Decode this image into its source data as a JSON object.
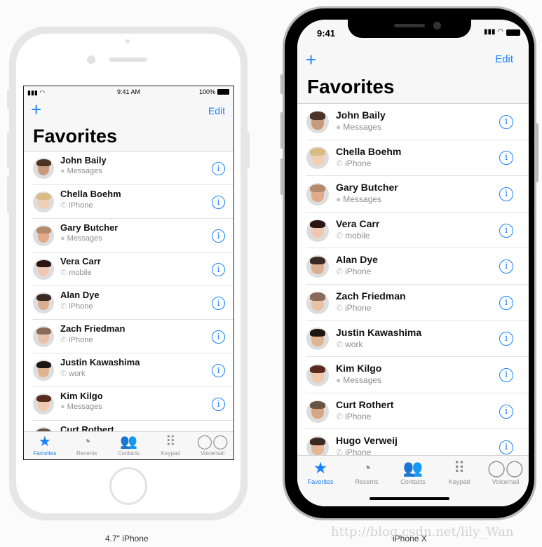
{
  "captions": {
    "left": "4.7\" iPhone",
    "right": "iPhone X"
  },
  "watermark": "http://blog.csdn.net/lily_Wan",
  "status_left": {
    "time": "9:41 AM",
    "battery": "100%"
  },
  "status_right": {
    "time": "9:41"
  },
  "nav": {
    "add_label": "+",
    "edit_label": "Edit",
    "title": "Favorites"
  },
  "accent": "#1a82fb",
  "contacts": [
    {
      "name": "John Baily",
      "type": "Messages",
      "icon": "message-icon",
      "skin": "#c89a7c",
      "hair": "#4a3426"
    },
    {
      "name": "Chella Boehm",
      "type": "iPhone",
      "icon": "phone-icon",
      "skin": "#f0cfb4",
      "hair": "#d9bb86"
    },
    {
      "name": "Gary Butcher",
      "type": "Messages",
      "icon": "message-icon",
      "skin": "#e2a98a",
      "hair": "#b48a6a"
    },
    {
      "name": "Vera Carr",
      "type": "mobile",
      "icon": "phone-icon",
      "skin": "#efc7b2",
      "hair": "#2a1512"
    },
    {
      "name": "Alan Dye",
      "type": "iPhone",
      "icon": "phone-icon",
      "skin": "#dcae92",
      "hair": "#3a2a22"
    },
    {
      "name": "Zach Friedman",
      "type": "iPhone",
      "icon": "phone-icon",
      "skin": "#e9c1a6",
      "hair": "#8a6a58"
    },
    {
      "name": "Justin Kawashima",
      "type": "work",
      "icon": "phone-icon",
      "skin": "#e0b48e",
      "hair": "#1f1612"
    },
    {
      "name": "Kim Kilgo",
      "type": "Messages",
      "icon": "message-icon",
      "skin": "#f0c9ad",
      "hair": "#5a2a1e"
    },
    {
      "name": "Curt Rothert",
      "type": "iPhone",
      "icon": "phone-icon",
      "skin": "#d9a684",
      "hair": "#6a5444"
    },
    {
      "name": "Hugo Verweij",
      "type": "iPhone",
      "icon": "phone-icon",
      "skin": "#e5b697",
      "hair": "#3a2a20"
    }
  ],
  "tabs": [
    {
      "label": "Favorites",
      "icon": "star-icon",
      "active": true
    },
    {
      "label": "Recents",
      "icon": "clock-icon",
      "active": false
    },
    {
      "label": "Contacts",
      "icon": "contacts-icon",
      "active": false
    },
    {
      "label": "Keypad",
      "icon": "keypad-icon",
      "active": false
    },
    {
      "label": "Voicemail",
      "icon": "voicemail-icon",
      "active": false
    }
  ]
}
